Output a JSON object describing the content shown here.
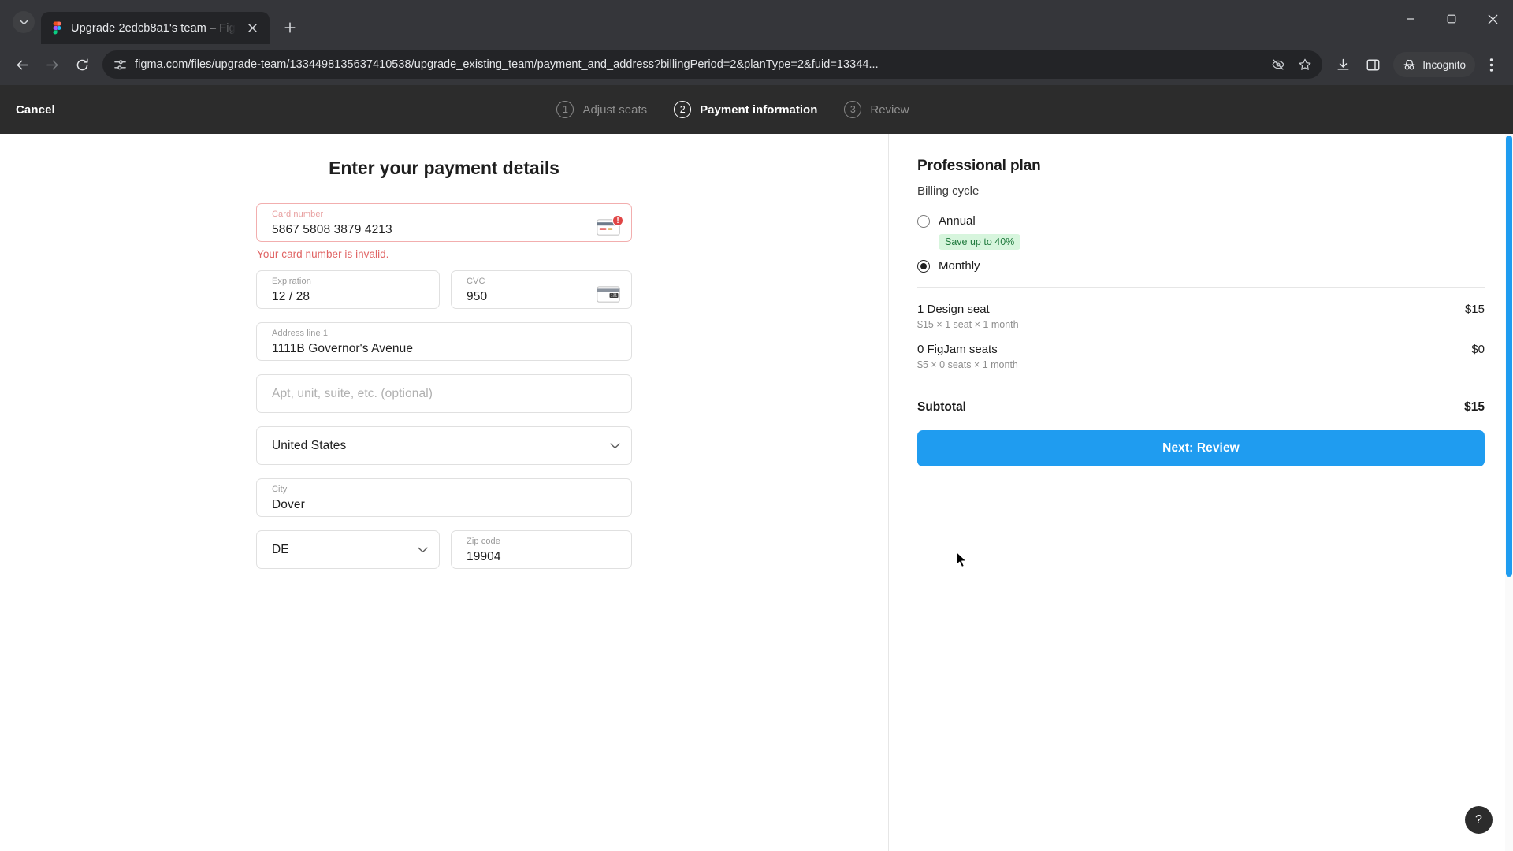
{
  "browser": {
    "tab": {
      "title": "Upgrade 2edcb8a1's team – Fig",
      "favicon": "figma-icon",
      "close_label": "×"
    },
    "new_tab_label": "+",
    "url": "figma.com/files/upgrade-team/1334498135637410538/upgrade_existing_team/payment_and_address?billingPeriod=2&planType=2&fuid=13344...",
    "profile_label": "Incognito",
    "window_controls": {
      "minimize": "—",
      "maximize": "▢",
      "close": "✕"
    }
  },
  "app_header": {
    "cancel_label": "Cancel",
    "steps": [
      {
        "num": "1",
        "label": "Adjust seats",
        "active": false
      },
      {
        "num": "2",
        "label": "Payment information",
        "active": true
      },
      {
        "num": "3",
        "label": "Review",
        "active": false
      }
    ]
  },
  "form": {
    "title": "Enter your payment details",
    "card_number": {
      "label": "Card number",
      "value": "5867 5808 3879 4213",
      "error": "Your card number is invalid.",
      "has_error": true
    },
    "expiration": {
      "label": "Expiration",
      "value": "12 / 28"
    },
    "cvc": {
      "label": "CVC",
      "value": "950"
    },
    "address_line_1": {
      "label": "Address line 1",
      "value": "1111B Governor's Avenue"
    },
    "address_line_2": {
      "placeholder": "Apt, unit, suite, etc. (optional)",
      "value": ""
    },
    "country": {
      "value": "United States"
    },
    "city": {
      "label": "City",
      "value": "Dover"
    },
    "state": {
      "value": "DE"
    },
    "zip": {
      "label": "Zip code",
      "value": "19904"
    }
  },
  "summary": {
    "plan_title": "Professional plan",
    "billing_cycle_label": "Billing cycle",
    "options": [
      {
        "label": "Annual",
        "selected": false,
        "badge": "Save up to 40%"
      },
      {
        "label": "Monthly",
        "selected": true,
        "badge": ""
      }
    ],
    "line_items": [
      {
        "name": "1 Design seat",
        "price": "$15",
        "detail": "$15 × 1 seat × 1 month"
      },
      {
        "name": "0 FigJam seats",
        "price": "$0",
        "detail": "$5 × 0 seats × 1 month"
      }
    ],
    "subtotal_label": "Subtotal",
    "subtotal_value": "$15",
    "cta_label": "Next: Review",
    "accent_color": "#1f9cf0",
    "badge_color": "#d7f5dd"
  },
  "help": {
    "label": "?"
  }
}
